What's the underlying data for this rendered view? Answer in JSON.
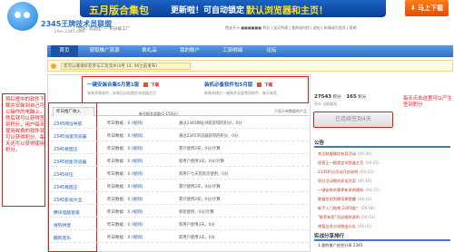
{
  "banner": {
    "headline": "五月版合集包",
    "mid": "更新啦！可自动锁定",
    "highlight": "默认浏览器和主页！",
    "download_label": "马上下载"
  },
  "logo": {
    "name": "2345王牌技术员联盟",
    "url": "jifen.2345.com"
  },
  "tagline": "您好, 欢迎您!  —  积分级工厂",
  "user": {
    "text": "首长开卡 ■■■■■■ 积分 | 宝贝列表 | 我的站内信 | 退出 | 申请成为会员 | 帮助"
  },
  "nav": {
    "items": [
      "首页",
      "获取推广资源",
      "换礼品",
      "我的账户",
      "工资明细",
      "论坛"
    ]
  },
  "notice": {
    "text": "您可以邀请好友参与工资流水(4月 14, 06之前发布)"
  },
  "left_annotation": "将红框中的软件下载并安装到自己可以操作的电脑上，然后就可以获得签到积分，用户每天使用收费的软件就可以获得积分，每天还可以获得使用积分。",
  "software": [
    {
      "title": "一键安装合集5月第1版",
      "sub": "安装多款软件，安装后自动锁定浏览器主页",
      "dl": "下载"
    },
    {
      "title": "装机必备软件包5月版",
      "sub": "新装系统后一键装齐全部常用软件，每天有奖",
      "dl": "下载"
    }
  ],
  "tabs": {
    "active": "昨日推广收入",
    "note": "只显示有数据的产品"
  },
  "reward_header": "新号报名奖励(1-150天)",
  "rows": [
    {
      "name": "2345网址导航",
      "stat": "昨日数据：0",
      "link": "(规则)",
      "desc": "通过2345网址导航获得的积分，0分"
    },
    {
      "name": "2345加速浏览器",
      "stat": "昨日数据：0",
      "link": "(规则)",
      "desc": "通过2345浏览器获得的积分，0分"
    },
    {
      "name": "2345看图王",
      "stat": "昨日数据：0",
      "link": "(规则)",
      "desc": "累计使用3天，0分/计算"
    },
    {
      "name": "2345智能浏览器",
      "stat": "昨日数据：0",
      "link": "(规则)",
      "desc": "新用户使用3天，0分/计算"
    },
    {
      "name": "2345好压",
      "stat": "昨日数据：0",
      "link": "(规则)",
      "desc": "新用户七天后再次使用，0分"
    },
    {
      "name": "2345看图王",
      "stat": "昨日数据：0",
      "link": "(规则)",
      "desc": "累计使用3天，0分/计算"
    },
    {
      "name": "2345影视大全",
      "stat": "昨日数据：0",
      "link": "(规则)",
      "desc": "累计使用3天，0分/计算"
    },
    {
      "name": "腾讯电脑管家",
      "stat": "昨日数据：0",
      "link": "(规则)",
      "desc": "新装使用，0分/计算"
    },
    {
      "name": "搜狗拼音",
      "stat": "昨日数据：0",
      "link": "(规则)",
      "desc": "新用户使用3天，0分"
    },
    {
      "name": "酷狗音乐",
      "stat": "昨日数据：0",
      "link": "(规则)",
      "desc": "新用户使用3天，0分"
    }
  ],
  "stats": {
    "score": "27543",
    "score_label": "积分",
    "count": "165",
    "count_label": "积分",
    "line2": "积分         当前级别"
  },
  "sign_button": "已连续签到4天",
  "right_annotation": "每天点击这里可以产生签到积分",
  "announcements": {
    "title": "公告",
    "items": [
      {
        "text": "关注联盟微信有奖活动",
        "date": "(04-30)"
      },
      {
        "text": "经营王一格锁定浏览器主页",
        "date": "(04-25)"
      },
      {
        "text": "2345积分活动开启说明",
        "date": "(04-22)"
      },
      {
        "text": "积分活动期间双倍兑奖",
        "date": "(04-18)"
      },
      {
        "text": "一键安装合集更新说明通知",
        "date": "(04-15)"
      },
      {
        "text": "联盟信用到期续期提醒",
        "date": "(04-10)"
      },
      {
        "text": "新手入门指南 2345推广",
        "date": "(04-08)"
      },
      {
        "text": "\"推荐有奖\"活动规则说明",
        "date": "(04-03)"
      },
      {
        "text": "增值业务分成推出公告",
        "date": "(04-01)"
      }
    ]
  },
  "activity": {
    "title": "实战分享排行",
    "first": "1.我的推广经验分享 2345"
  }
}
